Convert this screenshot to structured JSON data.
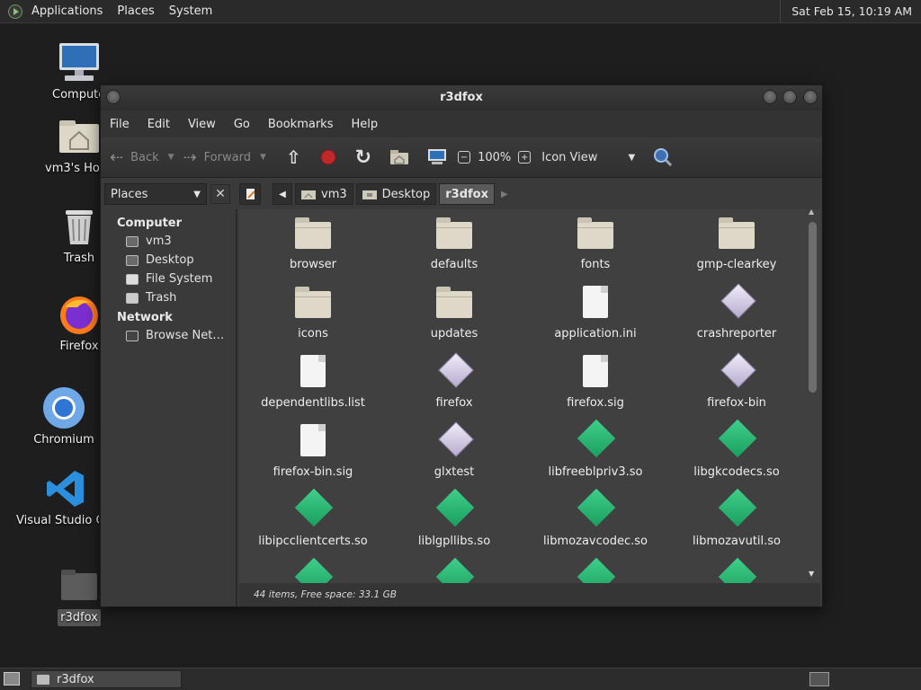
{
  "top_panel": {
    "menus": [
      "Applications",
      "Places",
      "System"
    ],
    "clock": "Sat Feb 15, 10:19 AM"
  },
  "desktop": {
    "icons": [
      {
        "label": "Computer",
        "icon": "computer-icon"
      },
      {
        "label": "vm3's Home",
        "icon": "home-folder-icon"
      },
      {
        "label": "Trash",
        "icon": "trash-icon"
      },
      {
        "label": "Firefox",
        "icon": "firefox-icon"
      },
      {
        "label": "Chromium",
        "icon": "chromium-icon"
      },
      {
        "label": "Visual Studio Code",
        "icon": "vscode-icon"
      },
      {
        "label": "r3dfox",
        "icon": "folder-icon"
      }
    ]
  },
  "window": {
    "title": "r3dfox",
    "menubar": [
      "File",
      "Edit",
      "View",
      "Go",
      "Bookmarks",
      "Help"
    ],
    "toolbar": {
      "back": "Back",
      "forward": "Forward",
      "zoom": "100%",
      "view_mode": "Icon View"
    },
    "location": {
      "places_label": "Places",
      "crumbs": [
        "vm3",
        "Desktop",
        "r3dfox"
      ]
    },
    "sidebar": {
      "sections": [
        {
          "header": "Computer",
          "items": [
            "vm3",
            "Desktop",
            "File System",
            "Trash"
          ]
        },
        {
          "header": "Network",
          "items": [
            "Browse Net…"
          ]
        }
      ]
    },
    "files": [
      {
        "name": "browser",
        "type": "folder"
      },
      {
        "name": "defaults",
        "type": "folder"
      },
      {
        "name": "fonts",
        "type": "folder"
      },
      {
        "name": "gmp-clearkey",
        "type": "folder"
      },
      {
        "name": "icons",
        "type": "folder"
      },
      {
        "name": "updates",
        "type": "folder"
      },
      {
        "name": "application.ini",
        "type": "file"
      },
      {
        "name": "crashreporter",
        "type": "executable"
      },
      {
        "name": "dependentlibs.list",
        "type": "file"
      },
      {
        "name": "firefox",
        "type": "executable"
      },
      {
        "name": "firefox.sig",
        "type": "file"
      },
      {
        "name": "firefox-bin",
        "type": "executable"
      },
      {
        "name": "firefox-bin.sig",
        "type": "file"
      },
      {
        "name": "glxtest",
        "type": "executable"
      },
      {
        "name": "libfreeblpriv3.so",
        "type": "library"
      },
      {
        "name": "libgkcodecs.so",
        "type": "library"
      },
      {
        "name": "libipcclientcerts.so",
        "type": "library"
      },
      {
        "name": "liblgpllibs.so",
        "type": "library"
      },
      {
        "name": "libmozavcodec.so",
        "type": "library"
      },
      {
        "name": "libmozavutil.so",
        "type": "library"
      },
      {
        "name": "",
        "type": "library"
      },
      {
        "name": "",
        "type": "library"
      },
      {
        "name": "",
        "type": "library"
      },
      {
        "name": "",
        "type": "library"
      }
    ],
    "status": "44 items, Free space: 33.1 GB"
  },
  "taskbar": {
    "task_label": "r3dfox"
  }
}
